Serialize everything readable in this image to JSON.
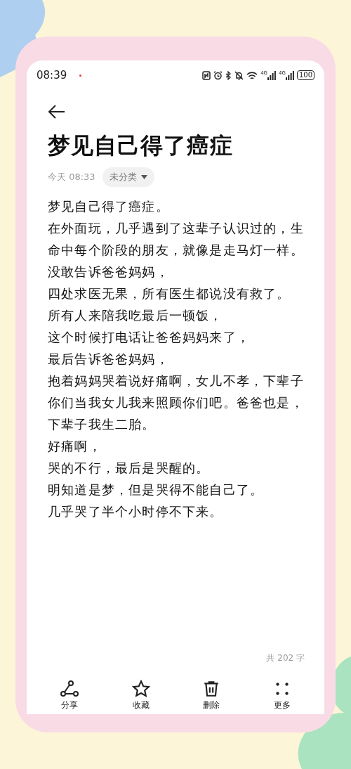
{
  "status_bar": {
    "time": "08:39",
    "signals": [
      {
        "label": "4G"
      },
      {
        "label": "4G"
      }
    ],
    "battery": "100"
  },
  "note": {
    "title": "梦见自己得了癌症",
    "date": "今天 08:33",
    "category": "未分类",
    "paragraphs": [
      "梦见自己得了癌症。",
      "在外面玩，几乎遇到了这辈子认识过的，生命中每个阶段的朋友，就像是走马灯一样。",
      "没敢告诉爸爸妈妈，",
      "四处求医无果，所有医生都说没有救了。",
      "所有人来陪我吃最后一顿饭，",
      "这个时候打电话让爸爸妈妈来了，",
      "最后告诉爸爸妈妈，",
      "抱着妈妈哭着说好痛啊，女儿不孝，下辈子你们当我女儿我来照顾你们吧。爸爸也是，下辈子我生二胎。",
      "好痛啊，",
      "哭的不行，最后是哭醒的。",
      "明知道是梦，但是哭得不能自己了。",
      "几乎哭了半个小时停不下来。"
    ],
    "word_count": "共 202 字"
  },
  "toolbar": [
    {
      "kind": "share",
      "label": "分享"
    },
    {
      "kind": "favorite",
      "label": "收藏"
    },
    {
      "kind": "delete",
      "label": "删除"
    },
    {
      "kind": "more",
      "label": "更多"
    }
  ]
}
